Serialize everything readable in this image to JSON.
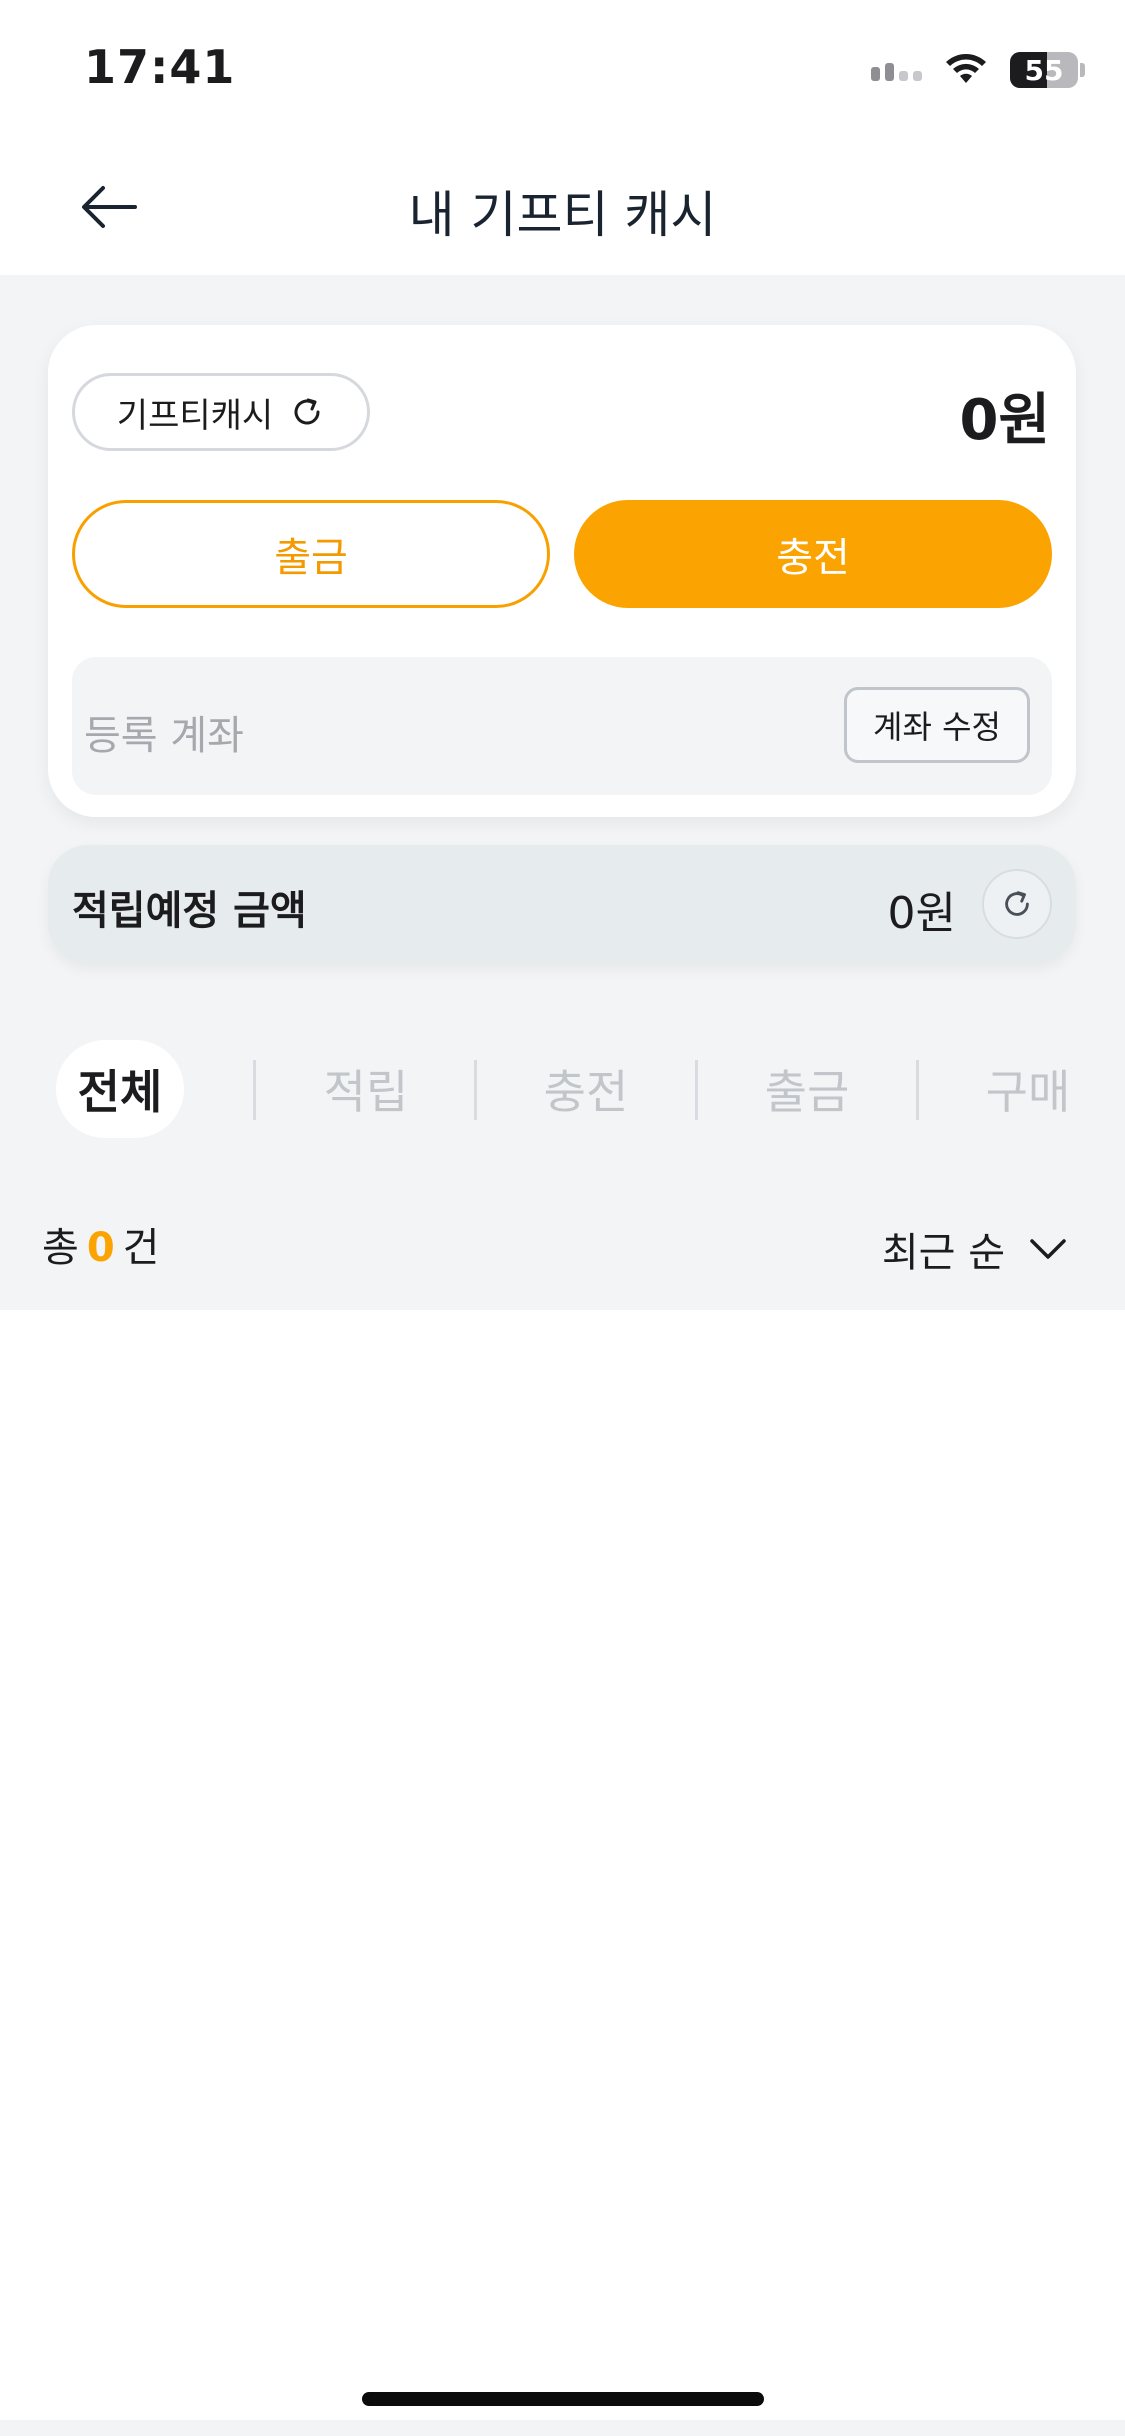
{
  "status_bar": {
    "time": "17:41",
    "battery": "55"
  },
  "header": {
    "title": "내 기프티 캐시",
    "back_icon": "arrow-left-icon"
  },
  "cash_card": {
    "chip_label": "기프티캐시",
    "chip_icon": "refresh-icon",
    "amount": "0원",
    "withdraw_label": "출금",
    "charge_label": "충전",
    "account_label": "등록 계좌",
    "account_edit_label": "계좌 수정"
  },
  "pending": {
    "label": "적립예정 금액",
    "amount": "0원",
    "icon": "refresh-icon"
  },
  "tabs": [
    {
      "label": "전체",
      "active": true
    },
    {
      "label": "적립",
      "active": false
    },
    {
      "label": "충전",
      "active": false
    },
    {
      "label": "출금",
      "active": false
    },
    {
      "label": "구매",
      "active": false
    }
  ],
  "list": {
    "count_prefix": "총",
    "count_value": "0",
    "count_suffix": "건",
    "sort_label": "최근 순",
    "sort_icon": "chevron-down-icon"
  },
  "colors": {
    "accent": "#FBA300",
    "background_gray": "#F2F4F6"
  }
}
